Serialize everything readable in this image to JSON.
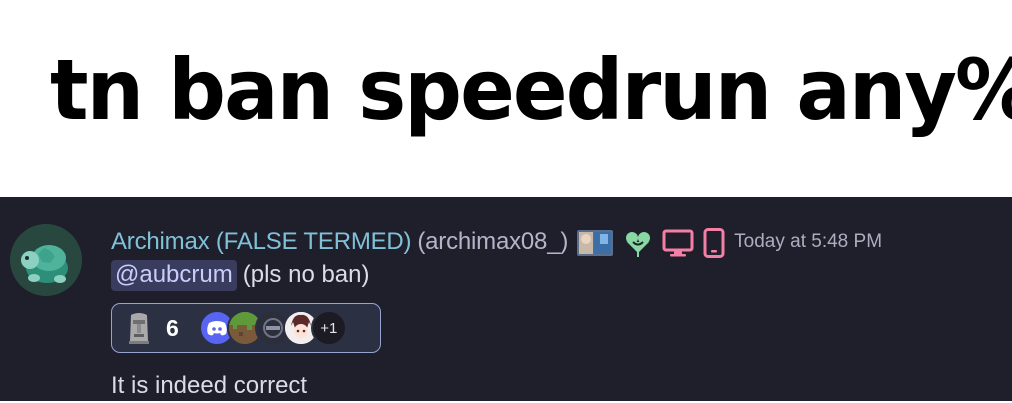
{
  "caption": {
    "text": "tn ban speedrun any%"
  },
  "message": {
    "display_name": "Archimax (FALSE TERMED)",
    "username": "(archimax08_)",
    "timestamp": "Today at 5:48 PM",
    "mention": "@aubcrum",
    "mention_rest": "(pls no ban)",
    "text": "It is indeed correct"
  },
  "reaction": {
    "emoji": "moai-emoji",
    "count": "6",
    "more_reactors": "+1"
  },
  "icons": {
    "avatar": "turtle-icon",
    "badge_1": "profile-photo-badge",
    "badge_2": "clover-heart-icon",
    "badge_3": "desktop-icon",
    "badge_4": "mobile-icon"
  },
  "colors": {
    "chat_background": "#1f1e2b",
    "display_name": "#7fc2d8",
    "mention_background": "#3a3c5e",
    "reaction_border": "#96a4cf",
    "status_pink": "#f47fa4",
    "badge_green": "#88d8a4"
  }
}
